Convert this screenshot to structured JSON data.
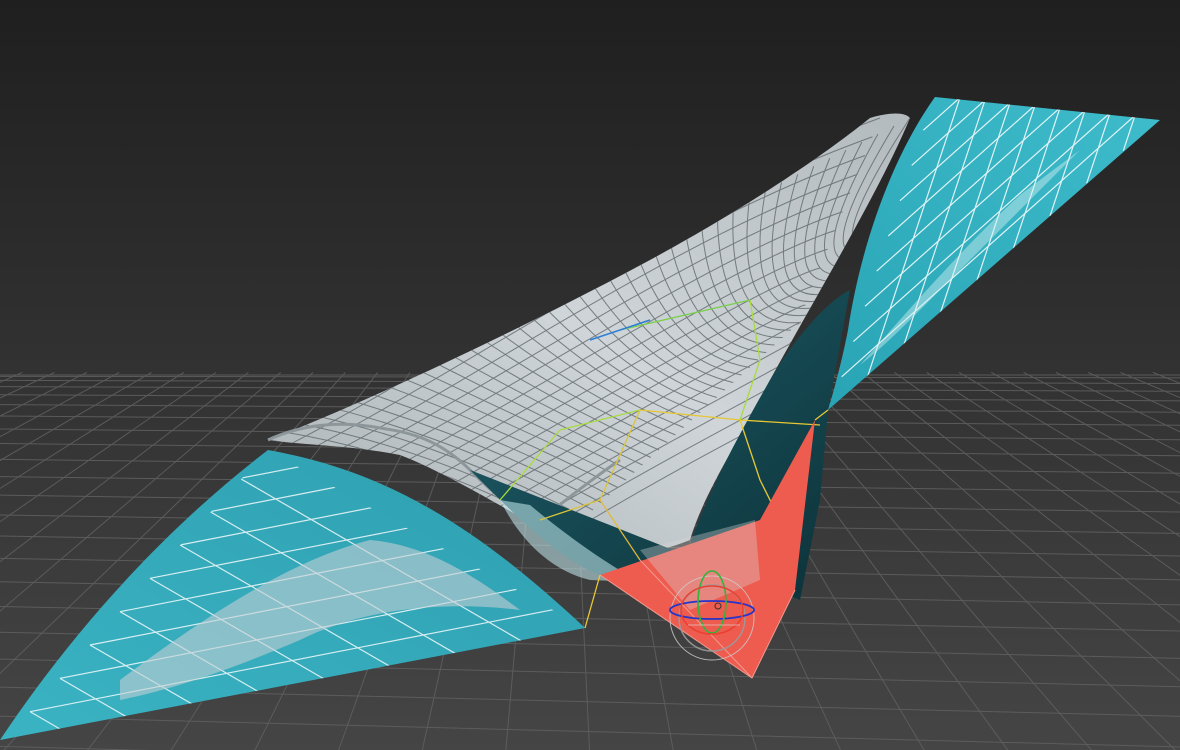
{
  "viewport": {
    "view": "perspective",
    "shading": "shaded-with-wireframe",
    "background_colors": [
      "#1e1e1e",
      "#444444"
    ],
    "grid_color": "#5f5f5f"
  },
  "scene": {
    "objects": [
      {
        "name": "cloth-sheet",
        "kind": "surface",
        "front_color": "#39b6c6",
        "back_color": "#b9c0c3",
        "wire_color": "#ffffff"
      },
      {
        "name": "selected-corner-faces",
        "kind": "face-selection",
        "color": "#ee5b4f"
      },
      {
        "name": "soft-selection-edges",
        "kind": "edge-highlight",
        "colors": [
          "#e7c832",
          "#a8dc3c",
          "#2e7ed6"
        ]
      }
    ],
    "gizmo": {
      "type": "rotate",
      "axis_colors": [
        "#e94031",
        "#2fb53a",
        "#2535c8",
        "#9a9a9a"
      ]
    }
  }
}
